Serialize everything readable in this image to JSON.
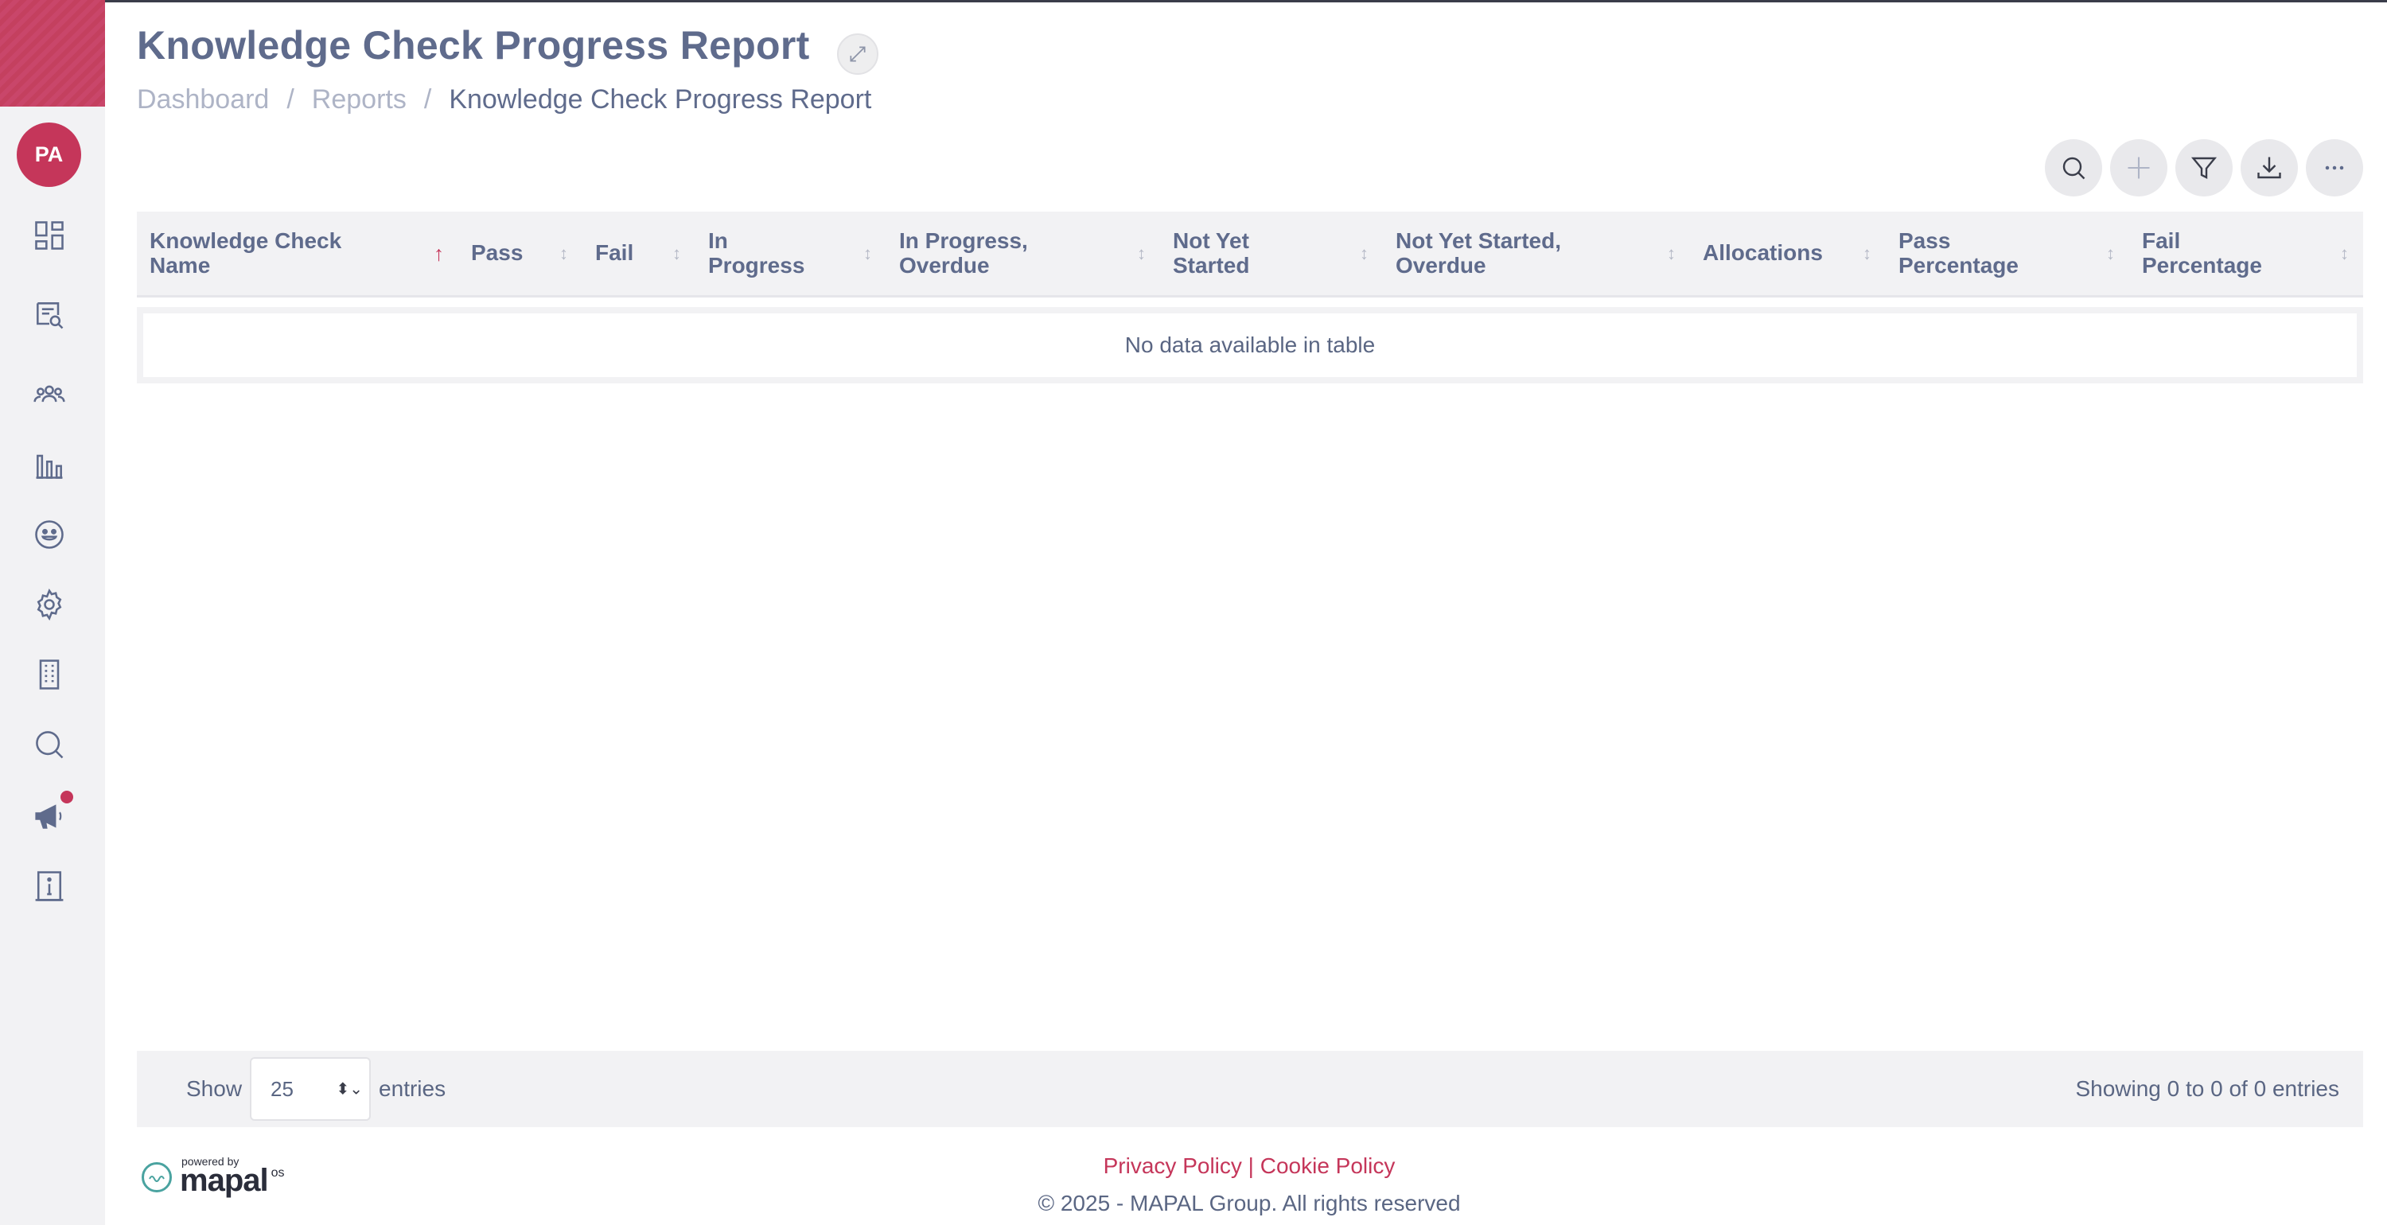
{
  "user": {
    "initials": "PA"
  },
  "header": {
    "title": "Knowledge Check Progress Report",
    "breadcrumb": [
      "Dashboard",
      "Reports",
      "Knowledge Check Progress Report"
    ]
  },
  "sidebar": {
    "icons": [
      "dashboard-icon",
      "reports-icon",
      "people-icon",
      "analytics-icon",
      "feedback-icon",
      "settings-icon",
      "building-icon",
      "search-icon",
      "announcements-icon",
      "info-icon"
    ]
  },
  "toolbar": [
    "search-icon",
    "add-icon",
    "filter-icon",
    "download-icon",
    "more-icon"
  ],
  "table": {
    "columns": [
      "Knowledge Check Name",
      "Pass",
      "Fail",
      "In Progress",
      "In Progress, Overdue",
      "Not Yet Started",
      "Not Yet Started, Overdue",
      "Allocations",
      "Pass Percentage",
      "Fail Percentage"
    ],
    "sorted_column": "Knowledge Check Name",
    "sort_direction": "asc",
    "empty_message": "No data available in table"
  },
  "pagination": {
    "show_label": "Show",
    "page_size": "25",
    "entries_label": "entries",
    "info": "Showing 0 to 0 of 0 entries"
  },
  "footer": {
    "privacy": "Privacy Policy",
    "separator": "|",
    "cookie": "Cookie Policy",
    "copyright": "© 2025 - MAPAL Group. All rights reserved",
    "powered_by": "powered by",
    "brand": "mapal",
    "brand_suffix": "os"
  },
  "colors": {
    "accent": "#c5365a",
    "text": "#5f6b8c",
    "sidebar_bg": "#f2f2f4"
  }
}
